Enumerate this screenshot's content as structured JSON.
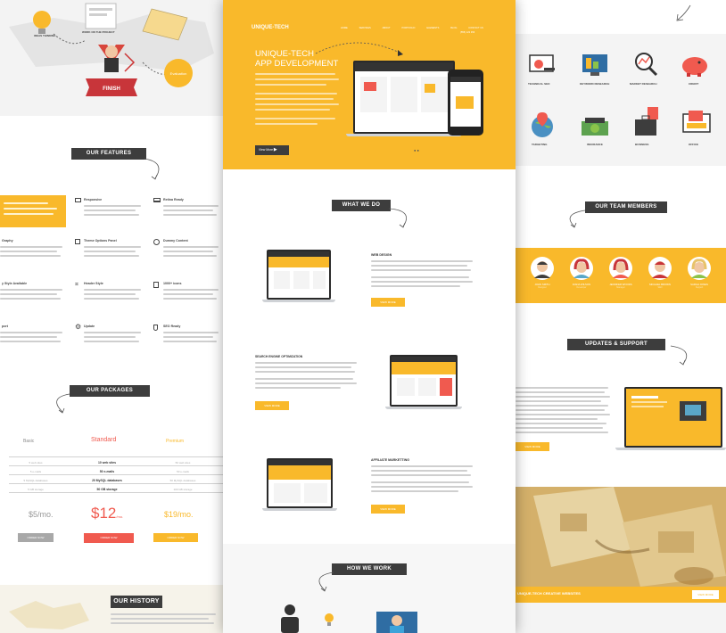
{
  "colors": {
    "accent": "#f9b92b",
    "dark": "#3d3d3d",
    "red": "#f05a4f",
    "gray": "#a8a8a8"
  },
  "left": {
    "hero": {
      "labels": {
        "lamp": "IDEAS\nTHINKING",
        "project": "WORK ON THE PROJECT",
        "banner": "FINISH",
        "circle": "Evaluation"
      }
    },
    "features": {
      "title": "OUR FEATURES",
      "items": [
        {
          "label": "",
          "icon": "feature-icon"
        },
        {
          "label": "Responsive",
          "icon": "monitor-icon"
        },
        {
          "label": "Retina Ready",
          "icon": "laptop-icon"
        },
        {
          "label": "Graphy",
          "icon": "pencil-icon"
        },
        {
          "label": "Theme Options Panel",
          "icon": "window-icon"
        },
        {
          "label": "Dummy Content",
          "icon": "smile-icon"
        },
        {
          "label": "y Style Available",
          "icon": "style-icon"
        },
        {
          "label": "Header Style",
          "icon": "header-icon"
        },
        {
          "label": "1000+ icons",
          "icon": "doc-icon"
        },
        {
          "label": "port",
          "icon": "support-icon"
        },
        {
          "label": "Update",
          "icon": "gear-icon"
        },
        {
          "label": "SEO Ready",
          "icon": "shield-icon"
        }
      ]
    },
    "packages": {
      "title": "OUR PACKAGES",
      "plans": [
        {
          "name": "Basic",
          "rows": [
            "5 web sites",
            "5 e-mails",
            "5 MySQL databases",
            "5 GB storage"
          ],
          "price": "$5/mo.",
          "button": "ORDER NOW"
        },
        {
          "name": "Standard",
          "rows": [
            "10 web sites",
            "50 e-mails",
            "20 MySQL databases",
            "50 GB storage"
          ],
          "price": "$12",
          "price_suffix": "/mo.",
          "button": "ORDER NOW"
        },
        {
          "name": "Premium",
          "rows": [
            "50 web sites",
            "50 e-mails",
            "50 MySQL databases",
            "100 GB storage"
          ],
          "price": "$19/mo.",
          "button": "ORDER NOW"
        }
      ]
    },
    "history": {
      "title": "OUR HISTORY"
    }
  },
  "center": {
    "brand": "UNIQUE-TECH",
    "nav": [
      "HOME",
      "SERVICES",
      "ABOUT",
      "PORTFOLIO",
      "ELEMENTS",
      "BLOG",
      "CONTACT US"
    ],
    "phone": "(555) 123 456",
    "hero_title_1": "UNIQUE-TECH",
    "hero_title_2": "APP DEVELOPMENT",
    "hero_button": "View More",
    "what_we_do": "WHAT WE DO",
    "services": [
      {
        "title": "WEB DESIGN",
        "button": "VIEW MORE"
      },
      {
        "title": "SEARCH ENGINE OPTIMIZATION",
        "button": "VIEW MORE"
      },
      {
        "title": "AFFILIATE MARKETTING",
        "button": "VIEW MORE"
      }
    ],
    "how_we_work": "HOW WE WORK"
  },
  "right": {
    "services": [
      {
        "label": "TECHNICAL SEO",
        "icon": "tools-icon"
      },
      {
        "label": "KEYWORD RESEARCH",
        "icon": "monitor-chart-icon"
      },
      {
        "label": "MARKET RESEARCH",
        "icon": "search-icon"
      },
      {
        "label": "CREDIT",
        "icon": "piggy-bank-icon"
      },
      {
        "label": "TARGETING",
        "icon": "globe-pin-icon"
      },
      {
        "label": "INSURANCE",
        "icon": "money-icon"
      },
      {
        "label": "BUSINESS",
        "icon": "briefcase-icon"
      },
      {
        "label": "OFFICE",
        "icon": "desktop-icon"
      }
    ],
    "team_title": "OUR TEAM MEMBERS",
    "team": [
      {
        "name": "JOHN SMITH",
        "role": "Designer"
      },
      {
        "name": "DIANA WILSON",
        "role": "Developer"
      },
      {
        "name": "JENNIFER WOODS",
        "role": "Manager"
      },
      {
        "name": "MICHAEL BROWN",
        "role": "SEO"
      },
      {
        "name": "SARAH JONES",
        "role": "Support"
      }
    ],
    "updates_title": "UPDATES & SUPPORT",
    "updates_button": "VIEW MORE",
    "creative_text": "UNIQUE-TECH CREATIVE WEBSITES",
    "creative_button": "VIEW MORE"
  }
}
